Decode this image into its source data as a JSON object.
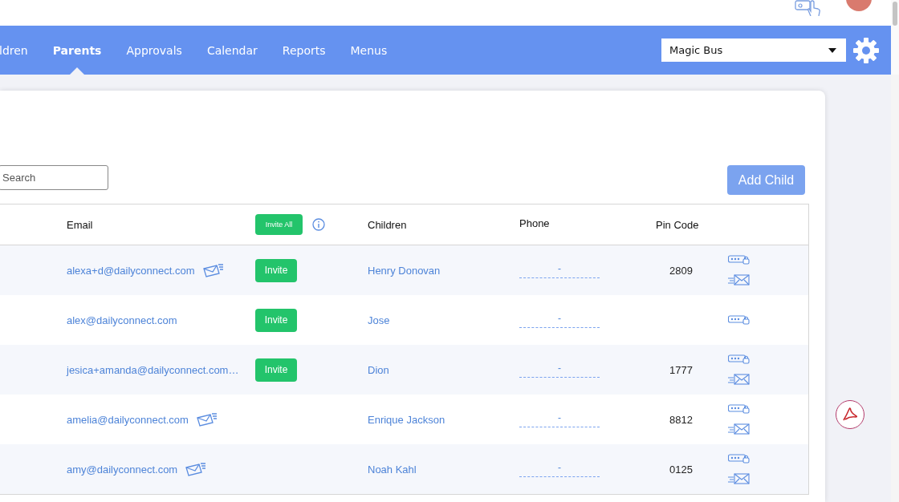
{
  "nav": {
    "tabs": [
      {
        "label": "ldren",
        "selected": false
      },
      {
        "label": "Parents",
        "selected": true
      },
      {
        "label": "Approvals",
        "selected": false
      },
      {
        "label": "Calendar",
        "selected": false
      },
      {
        "label": "Reports",
        "selected": false
      },
      {
        "label": "Menus",
        "selected": false
      }
    ],
    "school_select": {
      "value": "Magic Bus"
    }
  },
  "search": {
    "placeholder": "Search"
  },
  "add_button": "Add Child",
  "table": {
    "columns": {
      "email": "Email",
      "invite_all": "Invite All",
      "children": "Children",
      "phone": "Phone",
      "pin": "Pin Code"
    },
    "rows": [
      {
        "email": "alexa+d@dailyconnect.com",
        "sent": true,
        "invite": "Invite",
        "child": "Henry Donovan",
        "phone": "-",
        "pin": "2809",
        "resend": true
      },
      {
        "email": "alex@dailyconnect.com",
        "sent": false,
        "invite": "Invite",
        "child": "Jose",
        "phone": "-",
        "resend": false
      },
      {
        "email": "jesica+amanda@dailyconnect.com…",
        "sent": false,
        "invite": "Invite",
        "child": "Dion",
        "phone": "-",
        "pin": "1777",
        "resend": true
      },
      {
        "email": "amelia@dailyconnect.com",
        "sent": true,
        "child": "Enrique Jackson",
        "phone": "-",
        "pin": "8812",
        "resend": true
      },
      {
        "email": "amy@dailyconnect.com",
        "sent": true,
        "child": "Noah Kahl",
        "phone": "-",
        "pin": "0125",
        "resend": true
      }
    ]
  }
}
